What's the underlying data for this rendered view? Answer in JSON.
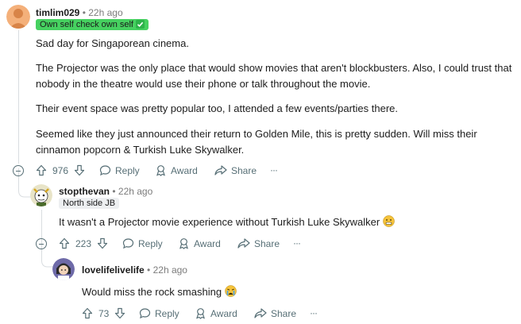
{
  "comments": [
    {
      "username": "timlim029",
      "time": "22h ago",
      "flair": "Own self check own self",
      "paragraphs": [
        "Sad day for Singaporean cinema.",
        "The Projector was the only place that would show movies that aren't blockbusters. Also, I could trust that nobody in the theatre would use their phone or talk throughout the movie.",
        "Their event space was pretty popular too, I attended a few events/parties there.",
        "Seemed like they just announced their return to Golden Mile, this is pretty sudden. Will miss their cinnamon popcorn & Turkish Luke Skywalker."
      ],
      "votes": "976"
    },
    {
      "username": "stopthevan",
      "time": "22h ago",
      "flair": "North side JB",
      "paragraphs": [
        "It wasn't a Projector movie experience without Turkish Luke Skywalker"
      ],
      "votes": "223"
    },
    {
      "username": "lovelifelivelife",
      "time": "22h ago",
      "paragraphs": [
        "Would miss the rock smashing"
      ],
      "votes": "73"
    }
  ],
  "actions": {
    "reply": "Reply",
    "award": "Award",
    "share": "Share",
    "more": "···"
  },
  "colors": {
    "flair_green": "#46d160",
    "flair_gray": "#edeff1",
    "meta": "#576f76"
  }
}
